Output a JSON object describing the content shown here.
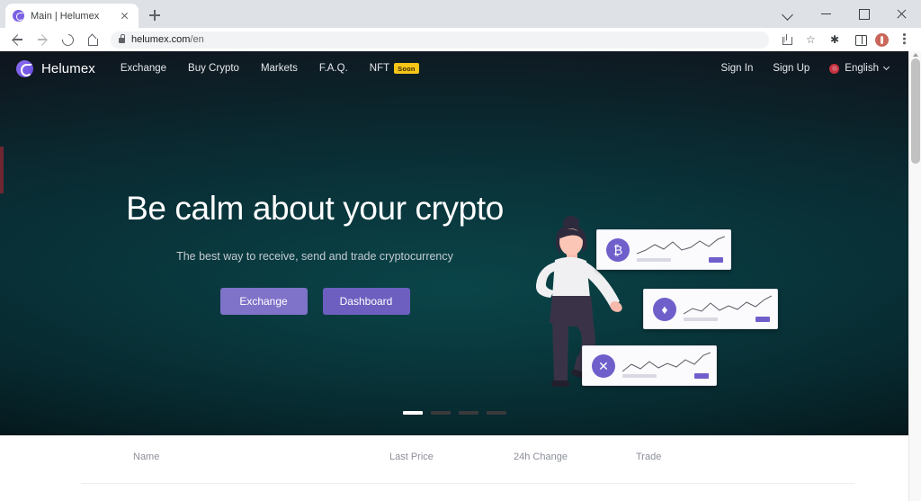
{
  "browser": {
    "tab": {
      "title": "Main | Helumex",
      "favicon": "helumex-logo-icon",
      "close": "×"
    },
    "new_tab_label": "+",
    "window_controls": {
      "chevron": "⌄",
      "minimize": "–",
      "maximize": "□",
      "close": "✕"
    },
    "toolbar": {
      "back": "←",
      "forward": "→",
      "reload": "⟳",
      "home": "⌂",
      "lock": "lock-icon",
      "url_host": "helumex.com",
      "url_path": "/en",
      "share": "share-icon",
      "bookmark": "☆",
      "extensions": "✱",
      "side_panel": "side-panel-icon",
      "profile": "profile-avatar",
      "menu": "⋮"
    }
  },
  "site": {
    "brand": {
      "name": "Helumex",
      "mark": "helumex-logo-icon"
    },
    "nav": [
      {
        "label": "Exchange"
      },
      {
        "label": "Buy Crypto"
      },
      {
        "label": "Markets"
      },
      {
        "label": "F.A.Q."
      },
      {
        "label": "NFT",
        "badge": "Soon"
      }
    ],
    "nav_right": {
      "sign_in": "Sign In",
      "sign_up": "Sign Up",
      "language": "English",
      "language_chevron": "chevron-down-icon",
      "flag": "flag-icon"
    },
    "hero": {
      "title": "Be calm about your crypto",
      "subtitle": "The best way to receive, send and trade cryptocurrency",
      "primary_button": "Exchange",
      "secondary_button": "Dashboard",
      "carousel": {
        "count": 4,
        "active_index": 0
      },
      "illustration": {
        "person": "person-illustration",
        "cards": [
          {
            "coin": "bitcoin-icon",
            "symbol": "₿"
          },
          {
            "coin": "ethereum-icon",
            "symbol": "♦"
          },
          {
            "coin": "xrp-icon",
            "symbol": "✕"
          }
        ]
      }
    },
    "markets": {
      "columns": [
        "Name",
        "Last Price",
        "24h Change",
        "Trade"
      ]
    }
  },
  "colors": {
    "accent_purple": "#6f5fcb",
    "button_primary": "#7f72c9",
    "button_secondary": "#6d5fc0",
    "badge_yellow": "#f5c518",
    "hero_teal": "#0b2a32"
  }
}
